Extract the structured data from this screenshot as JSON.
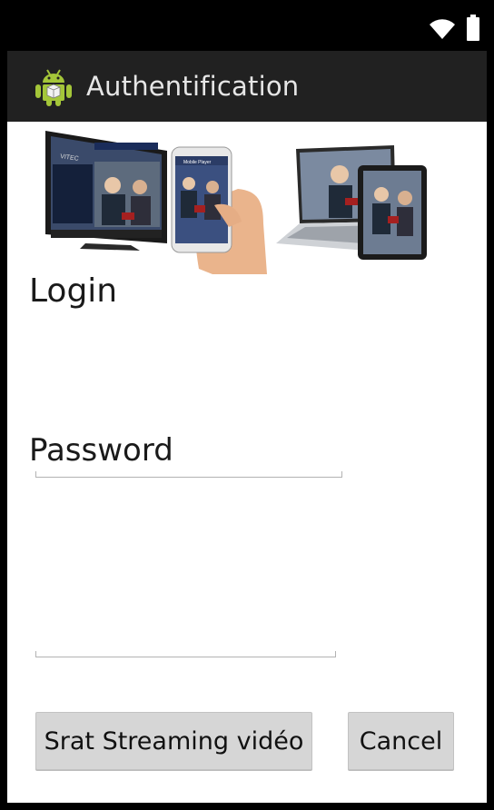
{
  "status_bar": {
    "icons": [
      "wifi-icon",
      "battery-icon"
    ]
  },
  "action_bar": {
    "app_icon": "android-icon",
    "title": "Authentification"
  },
  "banner": {
    "image": "multi-device-video-banner",
    "tv_brand": "VITEC",
    "phone_screen_text": "Mobile Player"
  },
  "form": {
    "login_label": "Login",
    "login_value": "",
    "password_label": "Password",
    "password_value": ""
  },
  "buttons": {
    "start_label": "Srat Streaming vidéo",
    "cancel_label": "Cancel"
  },
  "colors": {
    "action_bar_bg": "#212121",
    "status_bar_bg": "#000000",
    "button_bg": "#d6d6d6",
    "android_green": "#a4c639"
  }
}
